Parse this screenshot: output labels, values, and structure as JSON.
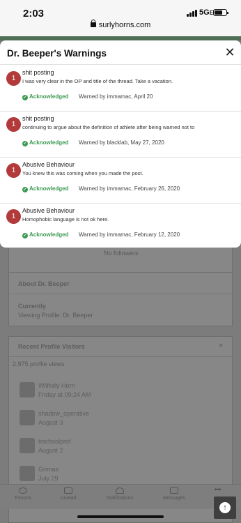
{
  "status_bar": {
    "time": "2:03",
    "network": "5G",
    "network_suffix": "E"
  },
  "browser": {
    "url": "surlyhorns.com"
  },
  "modal": {
    "title": "Dr. Beeper's Warnings",
    "warnings": [
      {
        "points": "1",
        "title": "shit posting",
        "description": "I was very clear in the OP and title of the thread. Take a vacation.",
        "status": "Acknowledged",
        "warned_by": "Warned by immamac, April 20"
      },
      {
        "points": "1",
        "title": "shit posting",
        "description": "continuing to argue about the definition of athlete after being warned not to",
        "status": "Acknowledged",
        "warned_by": "Warned by blacklab, May 27, 2020"
      },
      {
        "points": "1",
        "title": "Abusive Behaviour",
        "description": "You knew this was coming when you made the post.",
        "status": "Acknowledged",
        "warned_by": "Warned by immamac, February 26, 2020"
      },
      {
        "points": "1",
        "title": "Abusive Behaviour",
        "description": "Homophobic language is not ok here.",
        "status": "Acknowledged",
        "warned_by": "Warned by immamac, February 12, 2020"
      }
    ]
  },
  "profile": {
    "followers_text": "No followers",
    "about_title": "About Dr. Beeper",
    "currently_label": "Currently",
    "currently_value": "Viewing Profile: Dr. Beeper",
    "visitors_title": "Recent Profile Visitors",
    "visitors_close": "×",
    "views_text": "2,975 profile views",
    "visitors": [
      {
        "name": "Willfully Horn",
        "date": "Friday at 09:24 AM"
      },
      {
        "name": "shadow_operative",
        "date": "August 3"
      },
      {
        "name": "bschoolprof",
        "date": "August 2"
      },
      {
        "name": "Grimas",
        "date": "July 29"
      }
    ]
  },
  "tabbar": {
    "tabs": [
      {
        "label": "Forums"
      },
      {
        "label": "Unread"
      },
      {
        "label": "Notifications"
      },
      {
        "label": "Messages"
      }
    ],
    "more": "•••",
    "back_to_top": "↑"
  }
}
